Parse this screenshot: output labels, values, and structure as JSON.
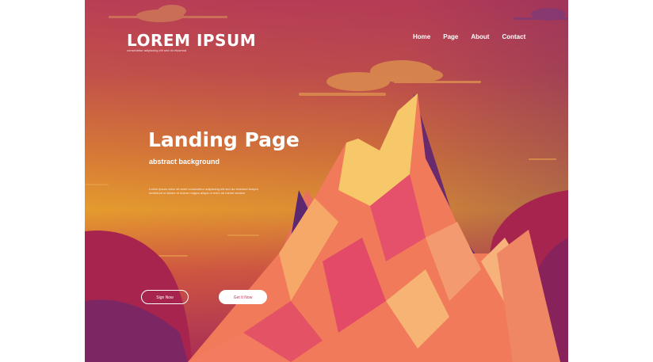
{
  "brand": {
    "logo_text": "LOREM IPSUM",
    "tagline": "consectetur adipiscing elit sed do eiusmod"
  },
  "nav": {
    "items": [
      {
        "label": "Home"
      },
      {
        "label": "Page"
      },
      {
        "label": "About"
      },
      {
        "label": "Contact"
      }
    ]
  },
  "hero": {
    "title": "Landing Page",
    "subtitle": "abstract background",
    "body": "Lorem ipsum dolor sit amet consectetur adipiscing elit sed do eiusmod tempor incididunt ut labore et dolore magna aliqua ut enim ad minim veniam"
  },
  "buttons": {
    "primary_label": "Sign Now",
    "secondary_label": "Get It Now"
  },
  "colors": {
    "sky_top": "#b83e55",
    "sky_mid": "#e89f2c",
    "mountain_light": "#f6c86a",
    "mountain_mid": "#f07a5a",
    "mountain_dark": "#6a2a6e",
    "hill": "#a7244f",
    "cloud": "#d9894e",
    "button_text": "#c4365a"
  }
}
